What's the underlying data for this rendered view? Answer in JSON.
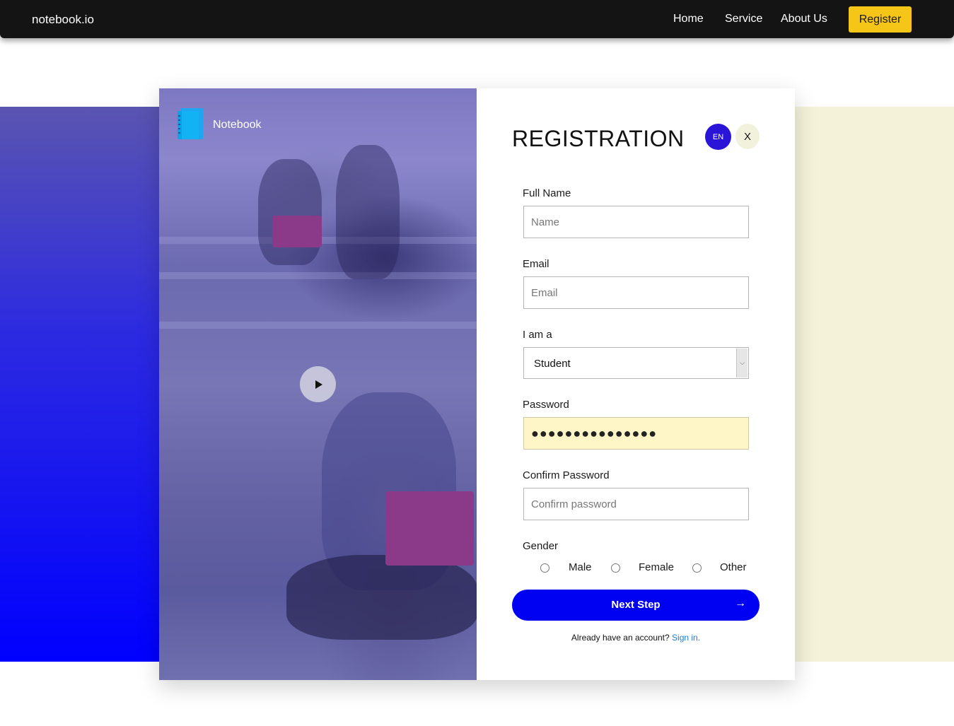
{
  "navbar": {
    "brand": "notebook.io",
    "links": [
      "Home",
      "Service",
      "About Us"
    ],
    "register_label": "Register"
  },
  "card": {
    "logo_name": "Notebook",
    "title": "REGISTRATION",
    "lang_label": "EN",
    "close_label": "X"
  },
  "form": {
    "full_name": {
      "label": "Full Name",
      "placeholder": "Name",
      "value": ""
    },
    "email": {
      "label": "Email",
      "placeholder": "Email",
      "value": ""
    },
    "role": {
      "label": "I am a",
      "selected": "Student"
    },
    "password": {
      "label": "Password",
      "value": "●●●●●●●●●●●●●●●"
    },
    "confirm_password": {
      "label": "Confirm Password",
      "placeholder": "Confirm password",
      "value": ""
    },
    "gender": {
      "label": "Gender",
      "options": [
        "Male",
        "Female",
        "Other"
      ]
    },
    "next_label": "Next Step",
    "next_arrow": "→",
    "signin_text": "Already have an account?",
    "signin_link": "Sign in."
  },
  "colors": {
    "navbar_bg": "#141414",
    "register_button": "#f5c518",
    "primary_button": "#0000f2",
    "lang_button": "#2a14d8",
    "password_fill": "#fff6c7",
    "right_panel": "#f4f3d9"
  }
}
